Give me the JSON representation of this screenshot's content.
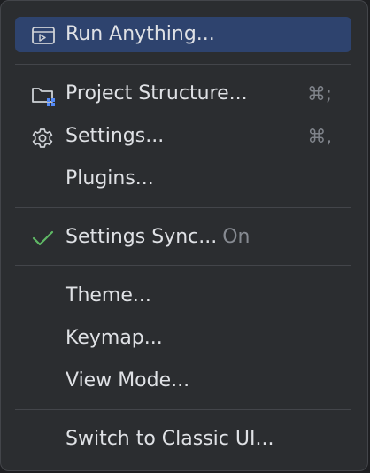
{
  "menu": {
    "run_anything": {
      "label": "Run Anything...",
      "icon": "run-anything-icon"
    },
    "project_structure": {
      "label": "Project Structure...",
      "shortcut": "⌘;",
      "icon": "project-structure-folder-icon"
    },
    "settings": {
      "label": "Settings...",
      "shortcut": "⌘,",
      "icon": "gear-icon"
    },
    "plugins": {
      "label": "Plugins..."
    },
    "settings_sync": {
      "label": "Settings Sync...",
      "status": "On",
      "icon": "check-icon"
    },
    "theme": {
      "label": "Theme..."
    },
    "keymap": {
      "label": "Keymap..."
    },
    "view_mode": {
      "label": "View Mode..."
    },
    "switch_ui": {
      "label": "Switch to Classic UI..."
    }
  },
  "colors": {
    "background": "#2b2d30",
    "selection": "#2e436e",
    "text": "#dfe1e5",
    "secondary_text": "#868a91",
    "check_green": "#5fb865",
    "accent_blue": "#548af7"
  }
}
